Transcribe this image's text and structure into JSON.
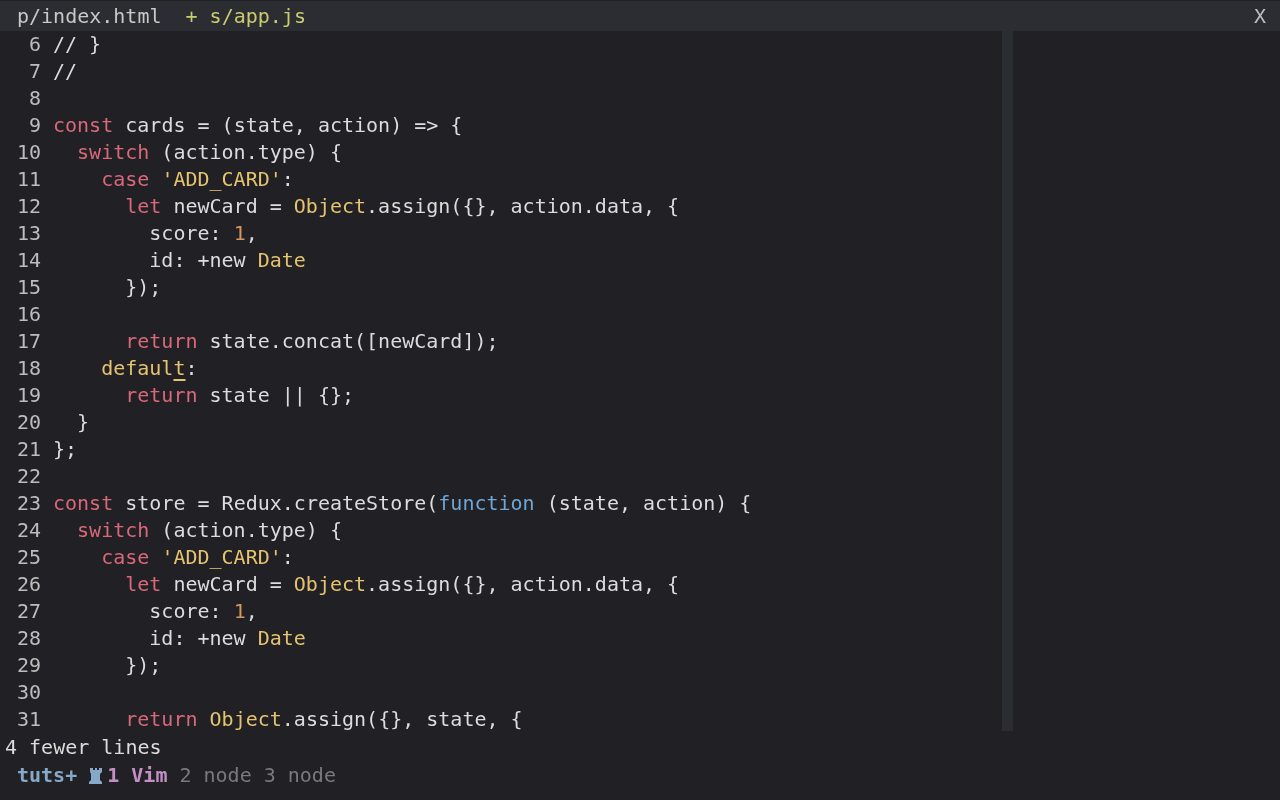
{
  "tabs": [
    {
      "label": "p/index.html",
      "selected": false
    },
    {
      "marker": "+",
      "label": "s/app.js",
      "selected": true
    }
  ],
  "close_label": "X",
  "lines": [
    {
      "number": "6",
      "tokens": [
        {
          "kind": "plain",
          "text": "// }"
        }
      ]
    },
    {
      "number": "7",
      "tokens": [
        {
          "kind": "plain",
          "text": "//"
        }
      ]
    },
    {
      "number": "8"
    },
    {
      "number": "9",
      "tokens": [
        {
          "kind": "keyword",
          "text": "const"
        },
        {
          "kind": "plain",
          "text": " cards = (state, action) => {"
        }
      ]
    },
    {
      "number": "10",
      "tokens": [
        {
          "kind": "keyword",
          "text": "  switch"
        },
        {
          "kind": "plain",
          "text": " (action.type) {"
        }
      ]
    },
    {
      "number": "11",
      "tokens": [
        {
          "kind": "keyword",
          "text": "    case "
        },
        {
          "kind": "string",
          "text": "'ADD_CARD'"
        },
        {
          "kind": "plain",
          "text": ":"
        }
      ]
    },
    {
      "number": "12",
      "tokens": [
        {
          "kind": "keyword",
          "text": "      let"
        },
        {
          "kind": "plain",
          "text": " newCard = "
        },
        {
          "kind": "type",
          "text": "Object"
        },
        {
          "kind": "plain",
          "text": ".assign({}, action.data, {"
        }
      ]
    },
    {
      "number": "13",
      "tokens": [
        {
          "kind": "plain",
          "text": "        score: "
        },
        {
          "kind": "number",
          "text": "1"
        },
        {
          "kind": "plain",
          "text": ","
        }
      ]
    },
    {
      "number": "14",
      "tokens": [
        {
          "kind": "plain",
          "text": "        id: +new "
        },
        {
          "kind": "type",
          "text": "Date"
        }
      ]
    },
    {
      "number": "15",
      "tokens": [
        {
          "kind": "plain",
          "text": "      });"
        }
      ]
    },
    {
      "number": "16"
    },
    {
      "number": "17",
      "tokens": [
        {
          "kind": "keyword",
          "text": "      return"
        },
        {
          "kind": "plain",
          "text": " state.concat([newCard]);"
        }
      ]
    },
    {
      "number": "18",
      "tokens": [
        {
          "kind": "type",
          "text": "    defaul"
        },
        {
          "kind": "cursor",
          "text": "t"
        },
        {
          "kind": "plain",
          "text": ":"
        }
      ]
    },
    {
      "number": "19",
      "tokens": [
        {
          "kind": "keyword",
          "text": "      return"
        },
        {
          "kind": "plain",
          "text": " state || {};"
        }
      ]
    },
    {
      "number": "20",
      "tokens": [
        {
          "kind": "plain",
          "text": "  }"
        }
      ]
    },
    {
      "number": "21",
      "tokens": [
        {
          "kind": "plain",
          "text": "};"
        }
      ]
    },
    {
      "number": "22"
    },
    {
      "number": "23",
      "tokens": [
        {
          "kind": "keyword",
          "text": "const"
        },
        {
          "kind": "plain",
          "text": " store = Redux.createStore("
        },
        {
          "kind": "function",
          "text": "function"
        },
        {
          "kind": "plain",
          "text": " (state, action) {"
        }
      ]
    },
    {
      "number": "24",
      "tokens": [
        {
          "kind": "keyword",
          "text": "  switch"
        },
        {
          "kind": "plain",
          "text": " (action.type) {"
        }
      ]
    },
    {
      "number": "25",
      "tokens": [
        {
          "kind": "keyword",
          "text": "    case "
        },
        {
          "kind": "string",
          "text": "'ADD_CARD'"
        },
        {
          "kind": "plain",
          "text": ":"
        }
      ]
    },
    {
      "number": "26",
      "tokens": [
        {
          "kind": "keyword",
          "text": "      let"
        },
        {
          "kind": "plain",
          "text": " newCard = "
        },
        {
          "kind": "type",
          "text": "Object"
        },
        {
          "kind": "plain",
          "text": ".assign({}, action.data, {"
        }
      ]
    },
    {
      "number": "27",
      "tokens": [
        {
          "kind": "plain",
          "text": "        score: "
        },
        {
          "kind": "number",
          "text": "1"
        },
        {
          "kind": "plain",
          "text": ","
        }
      ]
    },
    {
      "number": "28",
      "tokens": [
        {
          "kind": "plain",
          "text": "        id: +new "
        },
        {
          "kind": "type",
          "text": "Date"
        }
      ]
    },
    {
      "number": "29",
      "tokens": [
        {
          "kind": "plain",
          "text": "      });"
        }
      ]
    },
    {
      "number": "30"
    },
    {
      "number": "31",
      "tokens": [
        {
          "kind": "keyword",
          "text": "      return "
        },
        {
          "kind": "type",
          "text": "Object"
        },
        {
          "kind": "plain",
          "text": ".assign({}, state, {"
        }
      ]
    }
  ],
  "message": "4 fewer lines",
  "status_bar": {
    "session": "tuts+",
    "windows": [
      {
        "index": "1",
        "name": "Vim",
        "selected": true
      },
      {
        "index": "2",
        "name": "node",
        "selected": false
      },
      {
        "index": "3",
        "name": "node",
        "selected": false
      }
    ]
  }
}
